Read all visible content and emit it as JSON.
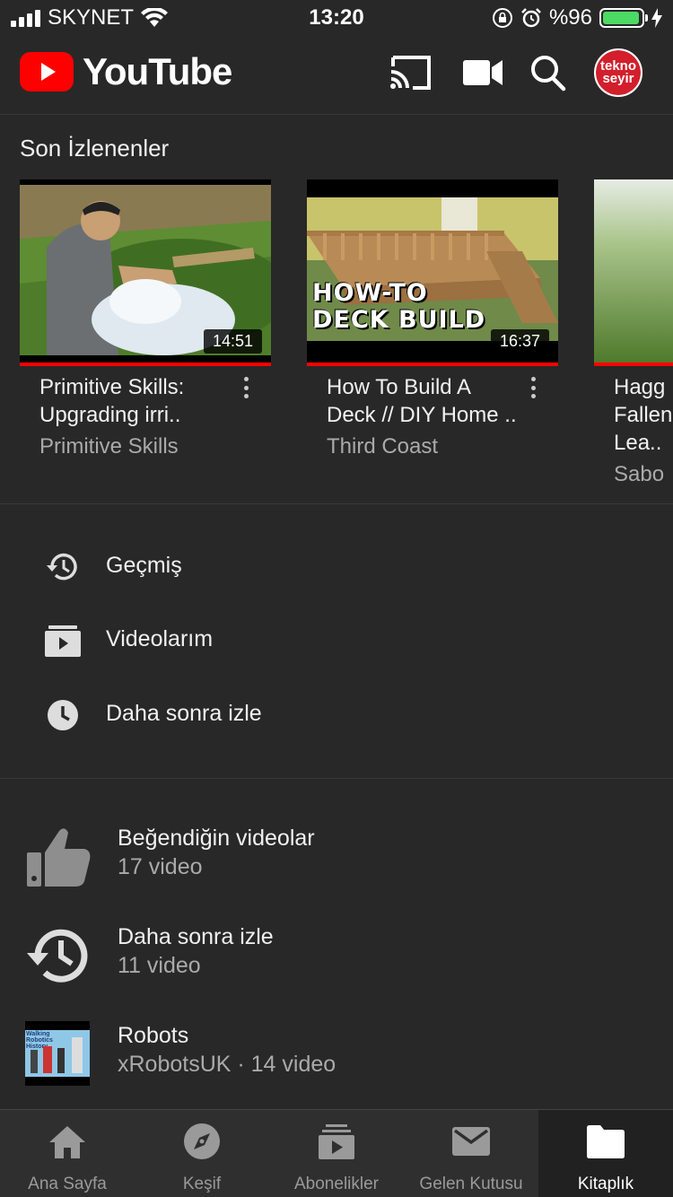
{
  "status_bar": {
    "carrier": "SKYNET",
    "time": "13:20",
    "battery_text": "%96",
    "battery_level": 0.96,
    "battery_color": "#4cd964"
  },
  "app": {
    "logo_text": "YouTube",
    "brand_color": "#ff0000",
    "icons": [
      "cast-icon",
      "camera-icon",
      "search-icon",
      "avatar"
    ],
    "avatar_text_1": "tekno",
    "avatar_text_2": "seyir"
  },
  "recent": {
    "title": "Son İzlenenler",
    "videos": [
      {
        "title": "Primitive Skills: Upgrading irri..",
        "channel": "Primitive Skills",
        "duration": "14:51",
        "watched": 1.0
      },
      {
        "title": "How To Build A Deck // DIY Home ..",
        "channel": "Third Coast",
        "duration": "16:37",
        "watched": 1.0,
        "thumb_text_1": "HOW-TO",
        "thumb_text_2": "DECK BUILD"
      },
      {
        "title": "Hagg Fallen Lea..",
        "channel": "Sabo",
        "watched": 1.0
      }
    ]
  },
  "menu": [
    {
      "label": "Geçmiş",
      "icon": "history-icon"
    },
    {
      "label": "Videolarım",
      "icon": "my-videos-icon"
    },
    {
      "label": "Daha sonra izle",
      "icon": "clock-icon"
    }
  ],
  "playlists": [
    {
      "title": "Beğendiğin videolar",
      "subtitle": "17 video",
      "icon": "thumbs-up-icon"
    },
    {
      "title": "Daha sonra izle",
      "subtitle": "11 video",
      "icon": "watch-later-icon"
    },
    {
      "title": "Robots",
      "subtitle": "xRobotsUK · 14 video",
      "icon": "playlist-thumbnail",
      "thumb_caption": "Walking Robotics History"
    }
  ],
  "bottom_nav": [
    {
      "label": "Ana Sayfa",
      "icon": "home-icon",
      "active": false
    },
    {
      "label": "Keşif",
      "icon": "explore-icon",
      "active": false
    },
    {
      "label": "Abonelikler",
      "icon": "subscriptions-icon",
      "active": false
    },
    {
      "label": "Gelen Kutusu",
      "icon": "inbox-icon",
      "active": false
    },
    {
      "label": "Kitaplık",
      "icon": "library-icon",
      "active": true
    }
  ]
}
